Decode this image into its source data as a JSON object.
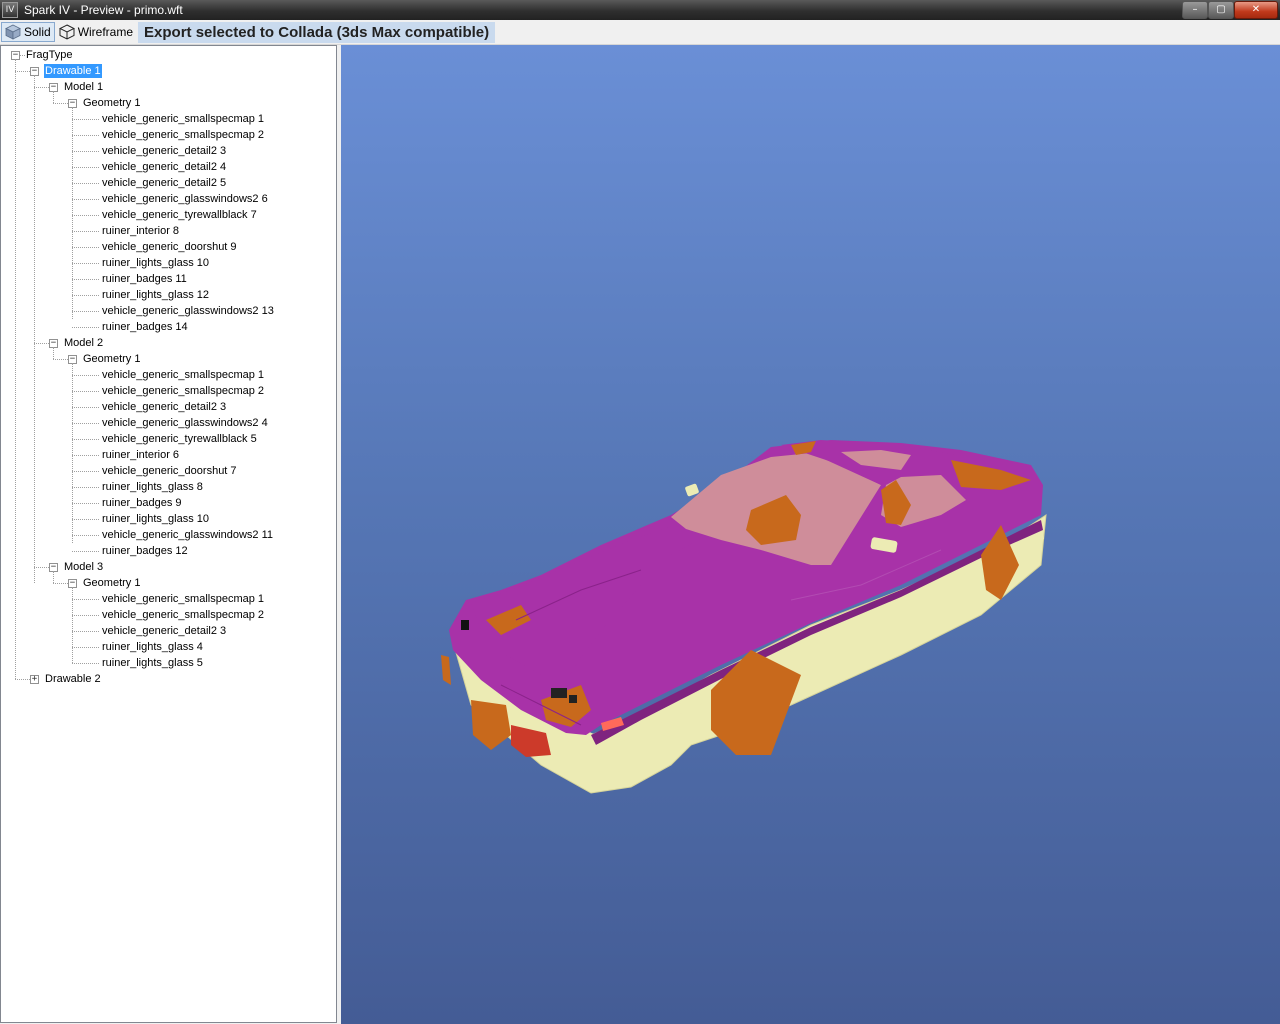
{
  "window": {
    "title": "Spark IV - Preview - primo.wft",
    "app_icon_text": "IV",
    "controls": {
      "minimize": "–",
      "maximize": "▢",
      "close": "✕"
    }
  },
  "toolbar": {
    "solid_label": "Solid",
    "wireframe_label": "Wireframe",
    "export_label": "Export selected to Collada (3ds Max compatible)"
  },
  "tree": {
    "root": "FragType",
    "drawable1": "Drawable 1",
    "drawable2": "Drawable 2",
    "models": [
      {
        "label": "Model 1",
        "geometry": "Geometry 1",
        "items": [
          "vehicle_generic_smallspecmap 1",
          "vehicle_generic_smallspecmap 2",
          "vehicle_generic_detail2 3",
          "vehicle_generic_detail2 4",
          "vehicle_generic_detail2 5",
          "vehicle_generic_glasswindows2 6",
          "vehicle_generic_tyrewallblack 7",
          "ruiner_interior 8",
          "vehicle_generic_doorshut 9",
          "ruiner_lights_glass 10",
          "ruiner_badges 11",
          "ruiner_lights_glass 12",
          "vehicle_generic_glasswindows2 13",
          "ruiner_badges 14"
        ]
      },
      {
        "label": "Model 2",
        "geometry": "Geometry 1",
        "items": [
          "vehicle_generic_smallspecmap 1",
          "vehicle_generic_smallspecmap 2",
          "vehicle_generic_detail2 3",
          "vehicle_generic_glasswindows2 4",
          "vehicle_generic_tyrewallblack 5",
          "ruiner_interior 6",
          "vehicle_generic_doorshut 7",
          "ruiner_lights_glass 8",
          "ruiner_badges 9",
          "ruiner_lights_glass 10",
          "vehicle_generic_glasswindows2 11",
          "ruiner_badges 12"
        ]
      },
      {
        "label": "Model 3",
        "geometry": "Geometry 1",
        "items": [
          "vehicle_generic_smallspecmap 1",
          "vehicle_generic_smallspecmap 2",
          "vehicle_generic_detail2 3",
          "ruiner_lights_glass 4",
          "ruiner_lights_glass 5"
        ]
      }
    ]
  },
  "viewport": {
    "colors": {
      "body": "#a832a8",
      "trim": "#ecebb4",
      "parts": "#c8691c",
      "glass": "#cf8d9a"
    }
  }
}
